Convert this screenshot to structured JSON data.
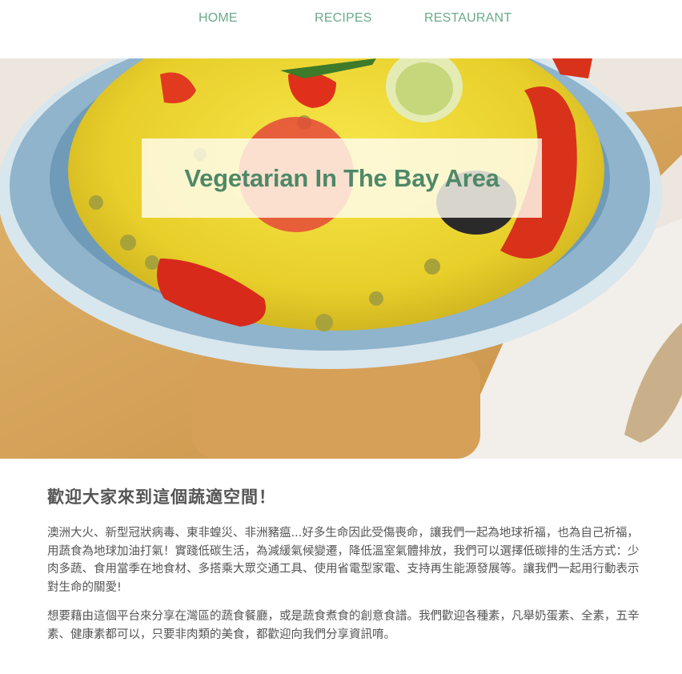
{
  "nav": {
    "items": [
      {
        "label": "HOME"
      },
      {
        "label": "RECIPES"
      },
      {
        "label": "RESTAURANT"
      }
    ]
  },
  "hero": {
    "title": "Vegetarian In The Bay Area"
  },
  "main": {
    "heading": "歡迎大家來到這個蔬適空間！",
    "paragraphs": [
      "澳洲大火、新型冠狀病毒、東非蝗災、非洲豬瘟...好多生命因此受傷喪命，讓我們一起為地球祈福，也為自己祈福，用蔬食為地球加油打氣！實踐低碳生活，為減緩氣候變遷，降低溫室氣體排放，我們可以選擇低碳排的生活方式：少肉多蔬、食用當季在地食材、多搭乘大眾交通工具、使用省電型家電、支持再生能源發展等。讓我們一起用行動表示對生命的關愛!",
      "想要藉由這個平台來分享在灣區的蔬食餐廳，或是蔬食煮食的創意食譜。我們歡迎各種素，凡舉奶蛋素、全素，五辛素、健康素都可以，只要非肉類的美食，都歡迎向我們分享資訊唷。"
    ]
  },
  "colors": {
    "nav_link": "#6aaa8a",
    "title": "#4e8868",
    "body_text": "#555555"
  }
}
